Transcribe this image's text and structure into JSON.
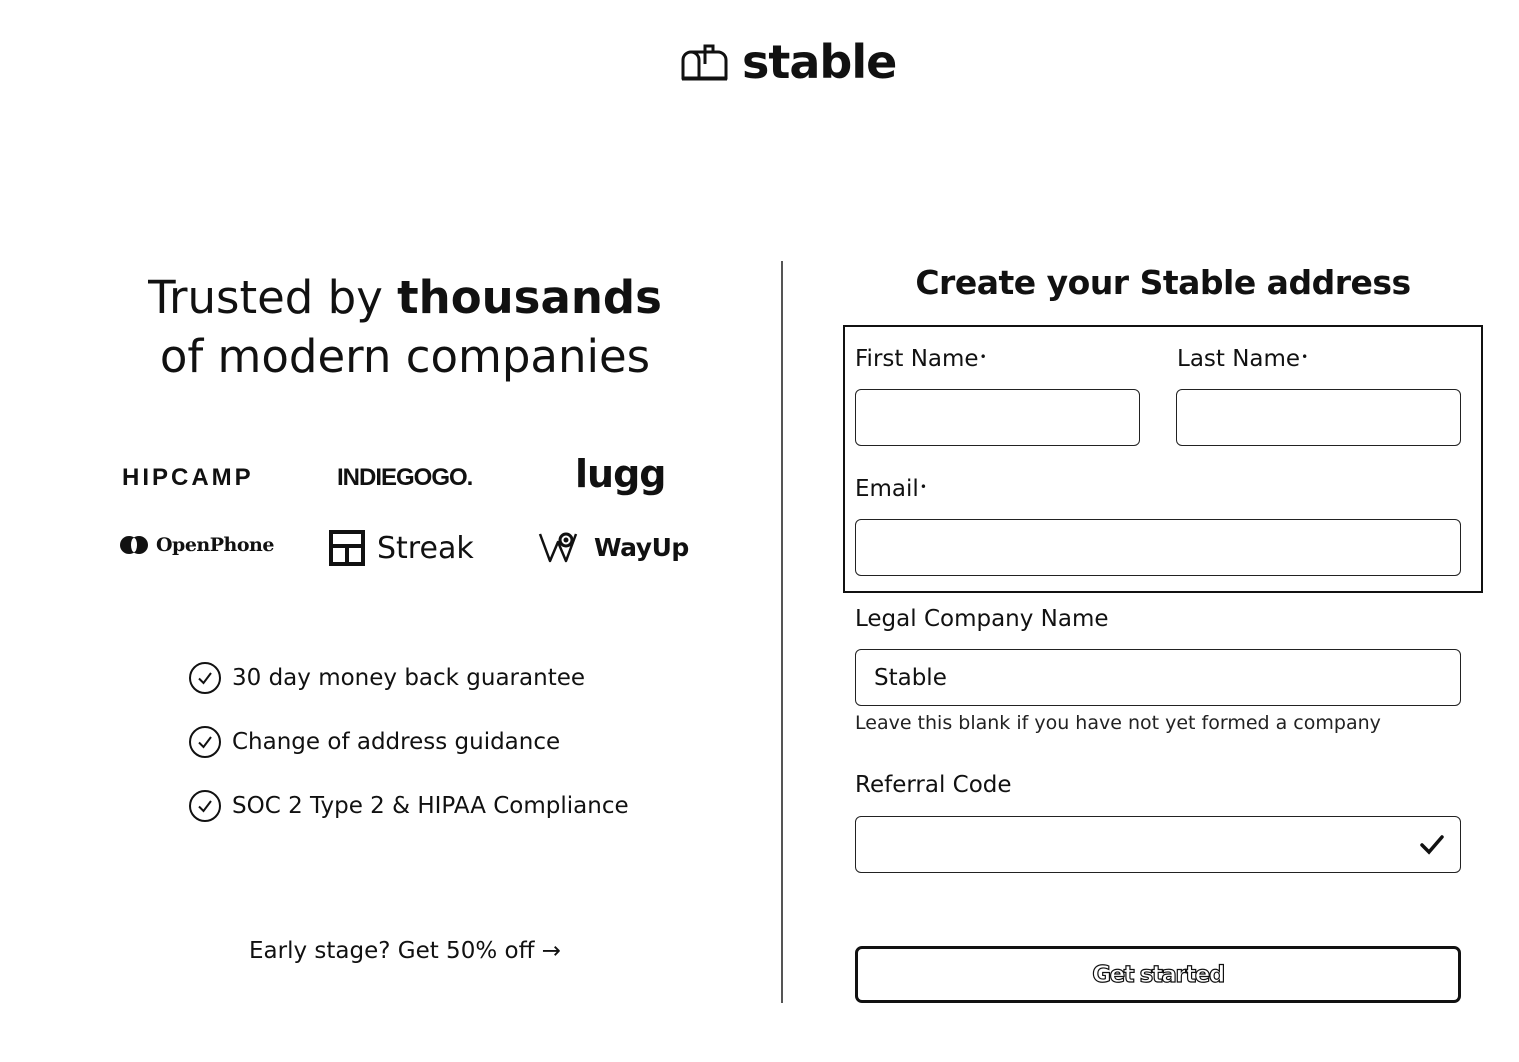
{
  "header": {
    "logo_text": "stable",
    "logo_icon": "mailbox-icon"
  },
  "left": {
    "headline_part1": "Trusted by ",
    "headline_bold": "thousands",
    "headline_part2": "of modern companies",
    "brands": [
      "HIPCAMP",
      "INDIEGOGO.",
      "lugg",
      "OpenPhone",
      "Streak",
      "WayUp"
    ],
    "features": [
      "30 day money back guarantee",
      "Change of address guidance",
      "SOC 2 Type 2 & HIPAA Compliance"
    ],
    "early_stage_link": "Early stage? Get 50% off →"
  },
  "form": {
    "title": "Create your Stable address",
    "first_name_label": "First Name",
    "first_name_value": "",
    "last_name_label": "Last Name",
    "last_name_value": "",
    "email_label": "Email",
    "email_value": "",
    "required_marker": "•",
    "company_label": "Legal Company Name",
    "company_value": "Stable",
    "company_hint": "Leave this blank if you have not yet formed a company",
    "referral_label": "Referral Code",
    "referral_value": "",
    "submit_label": "Get started"
  }
}
